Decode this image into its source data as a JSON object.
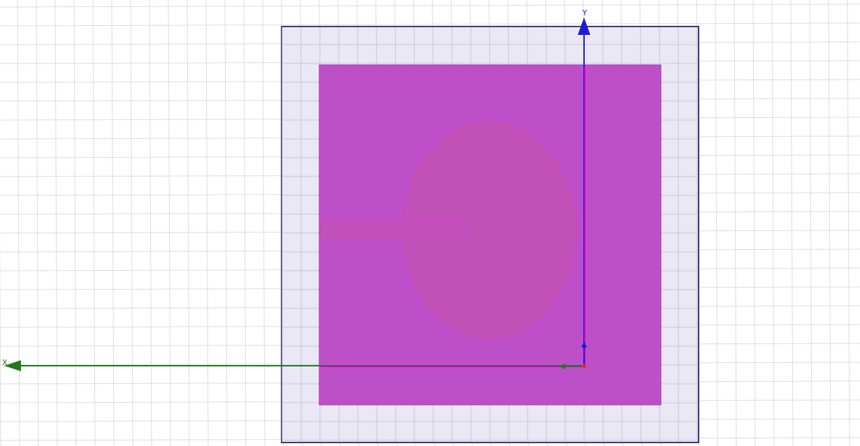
{
  "viewport": {
    "background_color": "#ffffff",
    "grid_color": "#dcdcdc"
  },
  "model": {
    "substrate": {
      "fill": "#e6e4f2",
      "stroke": "#3f3a70"
    },
    "ground_plane": {
      "fill": "#bd50c8",
      "stroke": "#a631b3"
    },
    "patch": {
      "fill": "#c052b8",
      "stroke": "#d040d0"
    },
    "feed_line": {
      "fill": "#c052b8",
      "stroke": "#d040d0"
    }
  },
  "axes": {
    "x": {
      "label": "X",
      "color": "#1f7a1f"
    },
    "y": {
      "label": "Y",
      "color": "#1a1ad8"
    },
    "highlight_color": "#d000d0",
    "origin_marker_color": "#e0303a"
  }
}
